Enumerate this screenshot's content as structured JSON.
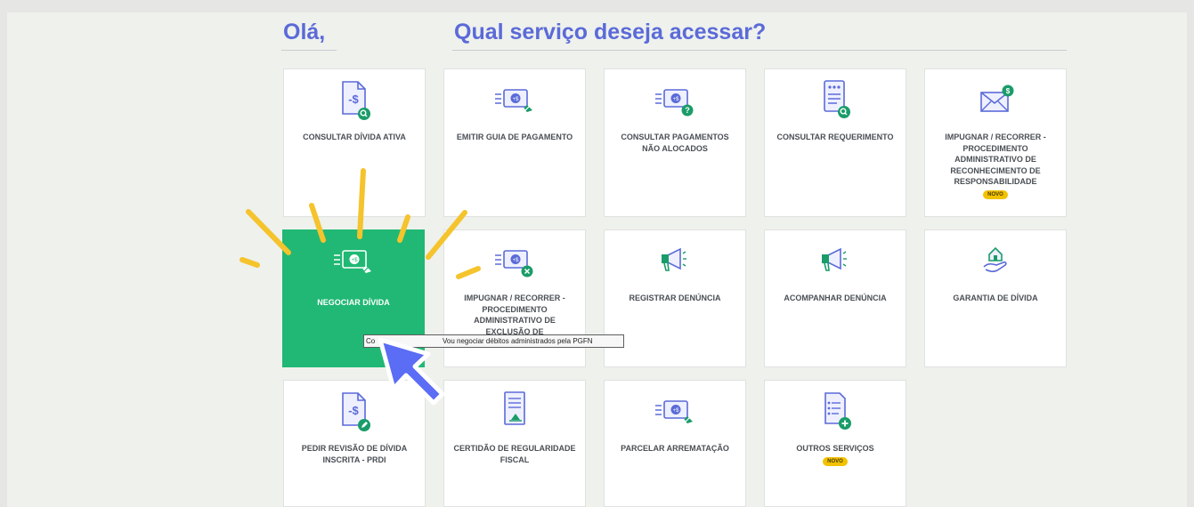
{
  "greeting": "Olá,",
  "question": "Qual serviço deseja acessar?",
  "colors": {
    "accent": "#5b6ad8",
    "active": "#20b874",
    "badge": "#f2c200",
    "sparkle": "#f5c32c",
    "cursor": "#5b6cf5"
  },
  "cards": {
    "consultar_divida": {
      "label": "CONSULTAR DÍVIDA ATIVA",
      "icon": "document-dollar-search-icon"
    },
    "emitir_guia": {
      "label": "EMITIR GUIA DE PAGAMENTO",
      "icon": "money-bill-check-icon"
    },
    "consultar_pagamentos": {
      "label": "CONSULTAR PAGAMENTOS NÃO ALOCADOS",
      "icon": "money-bill-question-icon"
    },
    "consultar_requerimento": {
      "label": "CONSULTAR REQUERIMENTO",
      "icon": "form-search-icon"
    },
    "impugnar_responsabilidade": {
      "label": "IMPUGNAR / RECORRER - PROCEDIMENTO ADMINISTRATIVO DE RECONHECIMENTO DE RESPONSABILIDADE",
      "badge": "NOVO",
      "icon": "envelope-dollar-icon"
    },
    "negociar_divida": {
      "label": "NEGOCIAR DÍVIDA",
      "icon": "money-bill-check-icon"
    },
    "impugnar_exclusao": {
      "label": "IMPUGNAR / RECORRER - PROCEDIMENTO ADMINISTRATIVO DE EXCLUSÃO DE PARCELAMENTO",
      "icon": "money-bill-cancel-icon"
    },
    "registrar_denuncia": {
      "label": "REGISTRAR DENÚNCIA",
      "icon": "megaphone-icon"
    },
    "acompanhar_denuncia": {
      "label": "ACOMPANHAR DENÚNCIA",
      "icon": "megaphone-icon"
    },
    "garantia_divida": {
      "label": "GARANTIA DE DÍVIDA",
      "icon": "hand-house-icon"
    },
    "pedir_revisao": {
      "label": "PEDIR REVISÃO DE DÍVIDA INSCRITA - PRDI",
      "icon": "document-dollar-edit-icon"
    },
    "certidao": {
      "label": "CERTIDÃO DE REGULARIDADE FISCAL",
      "icon": "certificate-document-icon"
    },
    "parcelar_arrematacao": {
      "label": "PARCELAR ARREMATAÇÃO",
      "icon": "money-bill-check-icon"
    },
    "outros_servicos": {
      "label": "OUTROS SERVIÇOS",
      "badge": "NOVO",
      "icon": "list-add-icon"
    }
  },
  "tooltip": {
    "left": "Co",
    "right": "Vou negociar débitos administrados pela PGFN"
  }
}
